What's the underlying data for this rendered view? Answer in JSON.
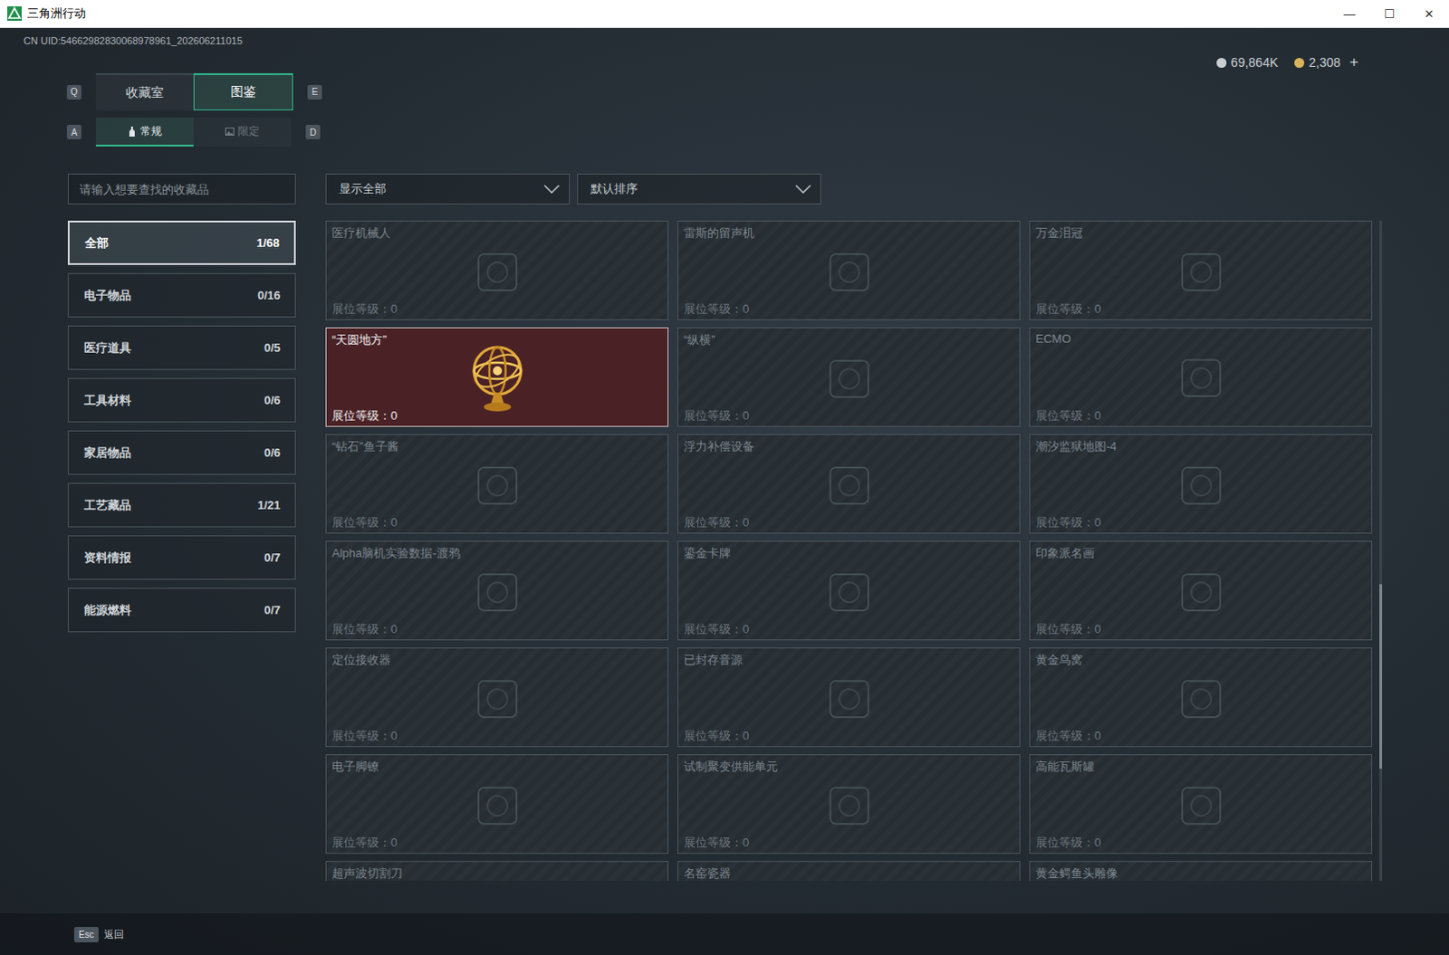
{
  "window": {
    "title": "三角洲行动",
    "controls": [
      "—",
      "☐",
      "✕"
    ]
  },
  "uid": "CN UID:54662982830068978961_202606211015",
  "currency": [
    {
      "value": "69,864K",
      "color": "#c9ced3"
    },
    {
      "value": "2,308",
      "color": "#d9b35a"
    }
  ],
  "currency_add": "+",
  "tabs": {
    "prev_key": "Q",
    "next_key": "E",
    "items": [
      {
        "label": "收藏室",
        "selected": false
      },
      {
        "label": "图鉴",
        "selected": true
      }
    ]
  },
  "subtabs": {
    "prev_key": "A",
    "next_key": "D",
    "items": [
      {
        "label": "常规",
        "selected": true,
        "disabled": false
      },
      {
        "label": "限定",
        "selected": false,
        "disabled": true
      }
    ]
  },
  "search": {
    "placeholder": "请输入想要查找的收藏品"
  },
  "filters": [
    {
      "label": "显示全部"
    },
    {
      "label": "默认排序"
    }
  ],
  "sidebar": {
    "items": [
      {
        "label": "全部",
        "count": "1/68",
        "selected": true
      },
      {
        "label": "电子物品",
        "count": "0/16",
        "selected": false
      },
      {
        "label": "医疗道具",
        "count": "0/5",
        "selected": false
      },
      {
        "label": "工具材料",
        "count": "0/6",
        "selected": false
      },
      {
        "label": "家居物品",
        "count": "0/6",
        "selected": false
      },
      {
        "label": "工艺藏品",
        "count": "1/21",
        "selected": false
      },
      {
        "label": "资料情报",
        "count": "0/7",
        "selected": false
      },
      {
        "label": "能源燃料",
        "count": "0/7",
        "selected": false
      }
    ]
  },
  "grid": {
    "level_label": "展位等级：",
    "scroll": {
      "offset": 0.55,
      "size": 0.28
    },
    "items": [
      {
        "name": "医疗机械人",
        "level": "0",
        "collected": false
      },
      {
        "name": "雷斯的留声机",
        "level": "0",
        "collected": false
      },
      {
        "name": "万金泪冠",
        "level": "0",
        "collected": false
      },
      {
        "name": "“天圆地方”",
        "level": "0",
        "collected": true
      },
      {
        "name": "“纵横”",
        "level": "0",
        "collected": false
      },
      {
        "name": "ECMO",
        "level": "0",
        "collected": false
      },
      {
        "name": "“钻石”鱼子酱",
        "level": "0",
        "collected": false
      },
      {
        "name": "浮力补偿设备",
        "level": "0",
        "collected": false
      },
      {
        "name": "潮汐监狱地图-4",
        "level": "0",
        "collected": false
      },
      {
        "name": "Alpha脑机实验数据-渡鸦",
        "level": "0",
        "collected": false
      },
      {
        "name": "鎏金卡牌",
        "level": "0",
        "collected": false
      },
      {
        "name": "印象派名画",
        "level": "0",
        "collected": false
      },
      {
        "name": "定位接收器",
        "level": "0",
        "collected": false
      },
      {
        "name": "已封存音源",
        "level": "0",
        "collected": false
      },
      {
        "name": "黄金鸟窝",
        "level": "0",
        "collected": false
      },
      {
        "name": "电子脚镣",
        "level": "0",
        "collected": false
      },
      {
        "name": "试制聚变供能单元",
        "level": "0",
        "collected": false
      },
      {
        "name": "高能瓦斯罐",
        "level": "0",
        "collected": false
      },
      {
        "name": "超声波切割刀",
        "level": null,
        "collected": false
      },
      {
        "name": "名窑瓷器",
        "level": null,
        "collected": false
      },
      {
        "name": "黄金鳄鱼头雕像",
        "level": null,
        "collected": false
      }
    ]
  },
  "footer": {
    "key": "Esc",
    "label": "返回"
  }
}
